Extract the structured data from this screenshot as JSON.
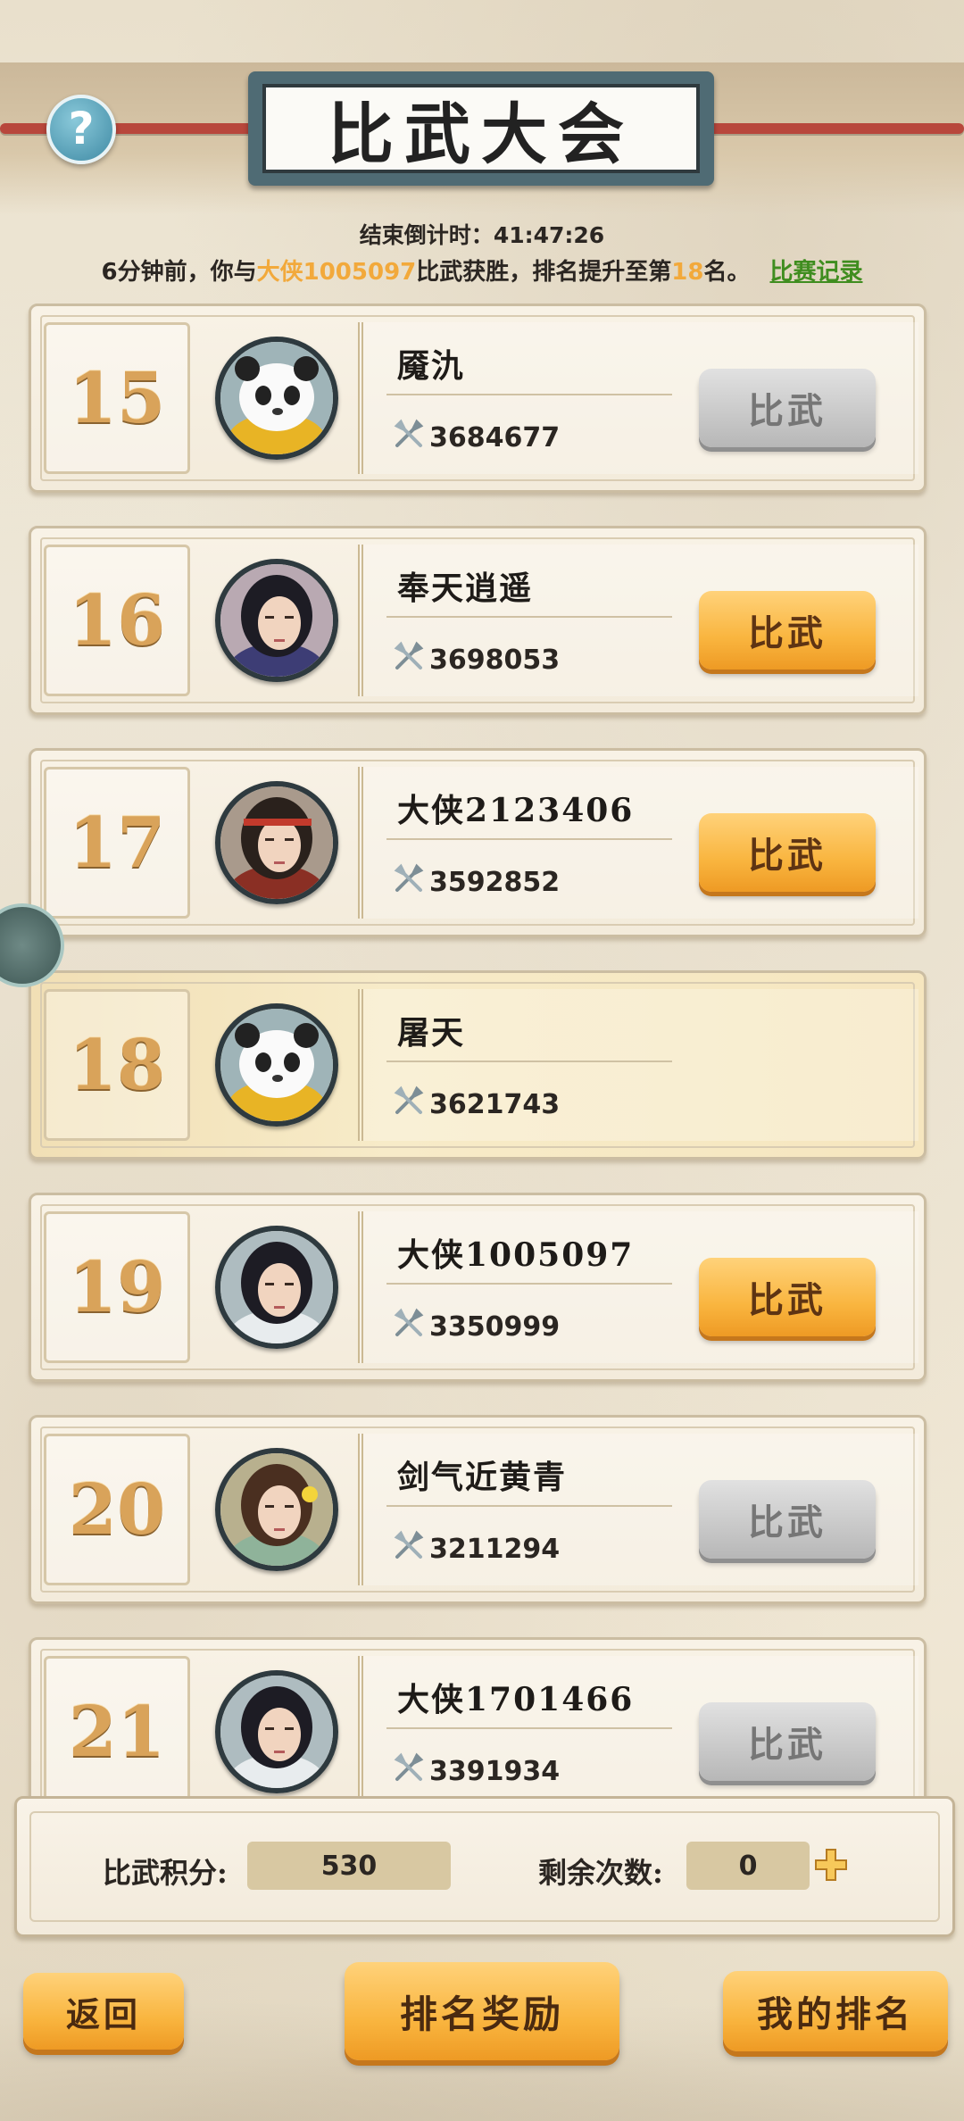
{
  "header": {
    "title": "比武大会",
    "help_icon": "question-icon",
    "countdown_label": "结束倒计时：",
    "countdown_value": "41:47:26"
  },
  "battle_message": {
    "prefix": "6分钟前，你与",
    "opponent": "大侠1005097",
    "middle": "比武获胜，排名提升至第",
    "rank": "18",
    "suffix": "名。",
    "record_link": "比赛记录"
  },
  "players": [
    {
      "rank": "15",
      "name": "魇氿",
      "power": "3684677",
      "button": "比武",
      "button_enabled": false,
      "avatar": "panda-avatar"
    },
    {
      "rank": "16",
      "name": "奉天逍遥",
      "power": "3698053",
      "button": "比武",
      "button_enabled": true,
      "avatar": "female-hero-avatar"
    },
    {
      "rank": "17",
      "name": "大侠2123406",
      "power": "3592852",
      "button": "比武",
      "button_enabled": true,
      "avatar": "headband-warrior-avatar"
    },
    {
      "rank": "18",
      "name": "屠天",
      "power": "3621743",
      "button": "",
      "button_enabled": false,
      "is_self": true,
      "avatar": "panda-avatar"
    },
    {
      "rank": "19",
      "name": "大侠1005097",
      "power": "3350999",
      "button": "比武",
      "button_enabled": true,
      "avatar": "male-swordsman-avatar"
    },
    {
      "rank": "20",
      "name": "剑气近黄青",
      "power": "3211294",
      "button": "比武",
      "button_enabled": false,
      "avatar": "flower-girl-avatar"
    },
    {
      "rank": "21",
      "name": "大侠1701466",
      "power": "3391934",
      "button": "比武",
      "button_enabled": false,
      "avatar": "male-swordsman-avatar"
    }
  ],
  "stats": {
    "points_label": "比武积分:",
    "points_value": "530",
    "remaining_label": "剩余次数:",
    "remaining_value": "0"
  },
  "footer": {
    "back": "返回",
    "rank_rewards": "排名奖励",
    "my_rank": "我的排名"
  },
  "colors": {
    "accent_orange": "#f9b53f",
    "link_green": "#3f8d1f",
    "highlight_orange": "#f2a93b"
  }
}
